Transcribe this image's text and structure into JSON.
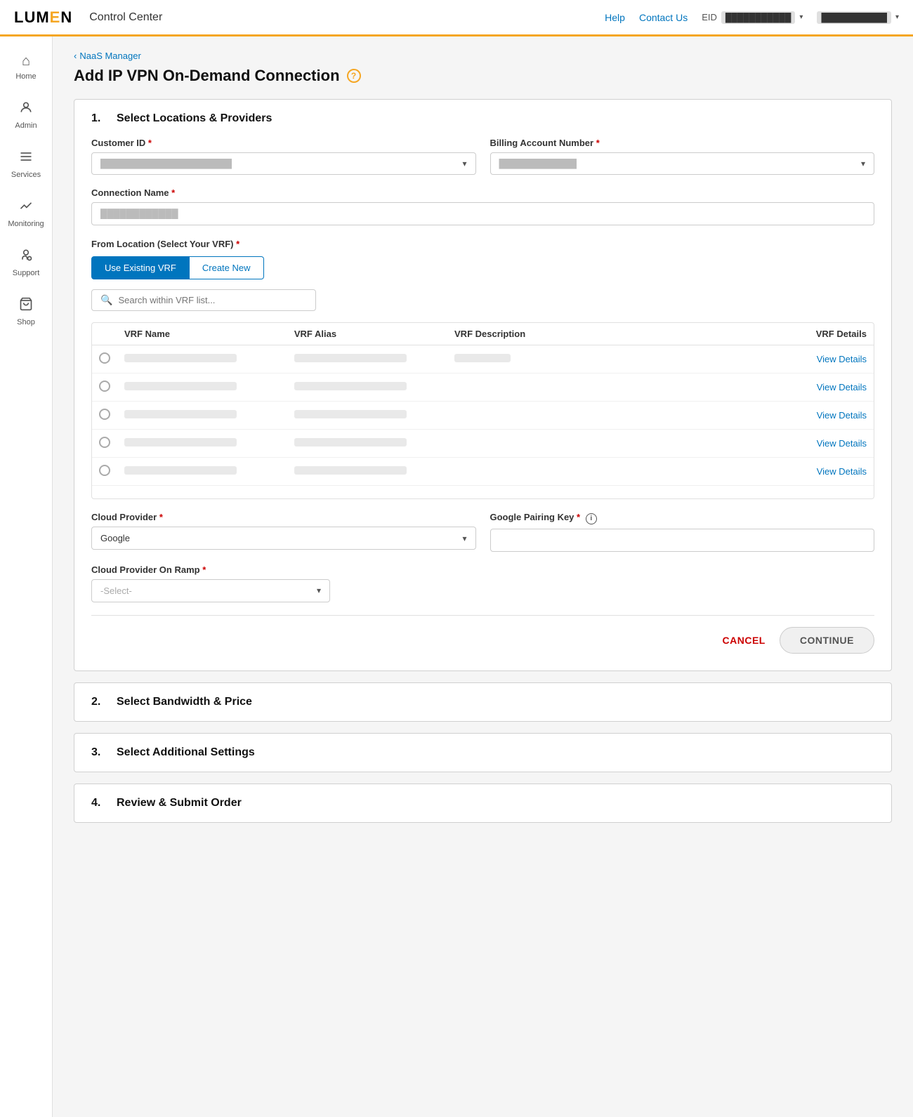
{
  "app": {
    "logo_text": "LUMEN",
    "logo_highlight": "E",
    "app_title": "Control Center",
    "help_link": "Help",
    "contact_link": "Contact Us",
    "eid_label": "EID",
    "eid_value": "███████████",
    "user_value": "███████████"
  },
  "sidebar": {
    "items": [
      {
        "id": "home",
        "label": "Home",
        "icon": "⌂"
      },
      {
        "id": "admin",
        "label": "Admin",
        "icon": "👤"
      },
      {
        "id": "services",
        "label": "Services",
        "icon": "☰"
      },
      {
        "id": "monitoring",
        "label": "Monitoring",
        "icon": "📈"
      },
      {
        "id": "support",
        "label": "Support",
        "icon": "👥"
      },
      {
        "id": "shop",
        "label": "Shop",
        "icon": "🛒"
      }
    ]
  },
  "breadcrumb": {
    "parent": "NaaS Manager",
    "arrow": "‹"
  },
  "page": {
    "title": "Add IP VPN On-Demand Connection",
    "help_icon": "?"
  },
  "steps": [
    {
      "number": "1.",
      "title": "Select Locations & Providers",
      "active": true
    },
    {
      "number": "2.",
      "title": "Select Bandwidth & Price",
      "active": false
    },
    {
      "number": "3.",
      "title": "Select Additional Settings",
      "active": false
    },
    {
      "number": "4.",
      "title": "Review & Submit Order",
      "active": false
    }
  ],
  "form": {
    "customer_id": {
      "label": "Customer ID",
      "required": true,
      "placeholder": "█████████████████",
      "value": ""
    },
    "billing_account": {
      "label": "Billing Account Number",
      "required": true,
      "placeholder": "██████████",
      "value": ""
    },
    "connection_name": {
      "label": "Connection Name",
      "required": true,
      "placeholder": "█████████████",
      "value": ""
    },
    "from_location": {
      "label": "From Location (Select Your VRF)",
      "required": true
    },
    "vrf_tabs": [
      {
        "id": "existing",
        "label": "Use Existing VRF",
        "active": true
      },
      {
        "id": "create_new",
        "label": "Create New",
        "active": false
      }
    ],
    "search": {
      "placeholder": "Search within VRF list..."
    },
    "vrf_table": {
      "columns": [
        "",
        "VRF Name",
        "VRF Alias",
        "VRF Description",
        "VRF Details"
      ],
      "rows": [
        {
          "name": "████████████████",
          "alias": "████████████████",
          "desc": "██",
          "link": "View Details"
        },
        {
          "name": "████████████████",
          "alias": "████████████████",
          "desc": "",
          "link": "View Details"
        },
        {
          "name": "████████████████",
          "alias": "████████████████",
          "desc": "",
          "link": "View Details"
        },
        {
          "name": "████████████████",
          "alias": "████████████████",
          "desc": "",
          "link": "View Details"
        },
        {
          "name": "████████████████",
          "alias": "████████████████",
          "desc": "",
          "link": "View Details"
        }
      ]
    },
    "cloud_provider": {
      "label": "Cloud Provider",
      "required": true,
      "value": "Google"
    },
    "google_pairing_key": {
      "label": "Google Pairing Key",
      "required": true,
      "info": true,
      "value": ""
    },
    "cloud_provider_on_ramp": {
      "label": "Cloud Provider On Ramp",
      "required": true,
      "placeholder": "-Select-",
      "value": ""
    },
    "cancel_btn": "CANCEL",
    "continue_btn": "CONTINUE"
  }
}
